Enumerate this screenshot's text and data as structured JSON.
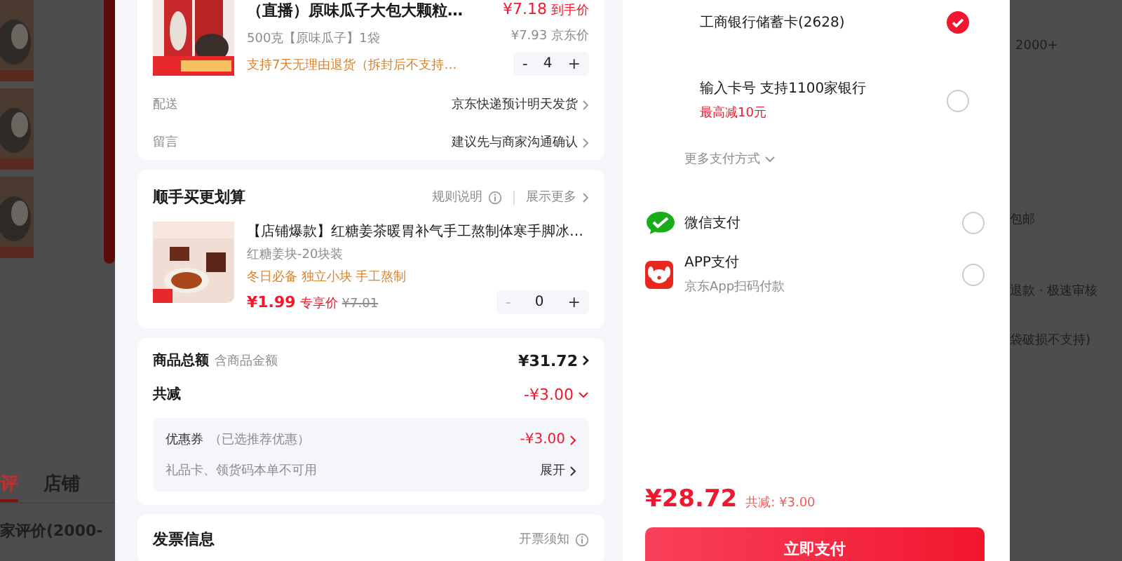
{
  "background_left": {
    "tabs": [
      {
        "label": "评",
        "selected": true
      },
      {
        "label": "店铺",
        "selected": false
      }
    ],
    "heading": "家评价(2000-"
  },
  "background_right": {
    "count": "2000+",
    "shipping": "包邮",
    "refund": "退款 · 极速审核",
    "note": "袋破损不支持)"
  },
  "order": {
    "product": {
      "title": "（直播）原味瓜子大包大颗粒…",
      "spec": "500克【原味瓜子】1袋",
      "promise": "支持7天无理由退货（拆封后不支持…",
      "price": "¥7.18",
      "price_label": "到手价",
      "jd_price": "¥7.93 京东价",
      "quantity": "4",
      "minus": "-",
      "plus": "+"
    },
    "rows": [
      {
        "label": "配送",
        "value": "京东快递预计明天发货"
      },
      {
        "label": "留言",
        "value": "建议先与商家沟通确认"
      }
    ]
  },
  "addon": {
    "title": "顺手买更划算",
    "rules": "规则说明",
    "more": "展示更多",
    "item": {
      "title": "【店铺爆款】红糖姜茶暖胃补气手工熬制体寒手脚冰…",
      "spec": "红糖姜块-20块装",
      "tags": "冬日必备 独立小块 手工熬制",
      "price": "¥1.99",
      "price_label": "专享价",
      "original_price": "¥7.01",
      "quantity": "0",
      "minus": "-",
      "plus": "+"
    }
  },
  "summary": {
    "total_label": "商品总额",
    "total_hint": "含商品金额",
    "total": "¥31.72",
    "discount_label": "共减",
    "discount": "-¥3.00",
    "coupon_label": "优惠券",
    "coupon_hint": "（已选推荐优惠）",
    "coupon_value": "-¥3.00",
    "gift_note": "礼品卡、领货码本单不可用",
    "expand": "展开"
  },
  "invoice": {
    "title": "发票信息",
    "notice": "开票须知"
  },
  "payment": {
    "methods": [
      {
        "kind": "card",
        "name": "工商银行储蓄卡(2628)",
        "selected": true
      },
      {
        "kind": "card",
        "name": "输入卡号 支持1100家银行",
        "promo": "最高减10元",
        "selected": false
      },
      {
        "kind": "more",
        "name": "更多支付方式"
      },
      {
        "kind": "wechat",
        "name": "微信支付",
        "selected": false
      },
      {
        "kind": "app",
        "name": "APP支付",
        "sub": "京东App扫码付款",
        "selected": false
      }
    ],
    "total": "¥28.72",
    "saved": "共减: ¥3.00",
    "pay_button": "立即支付"
  }
}
